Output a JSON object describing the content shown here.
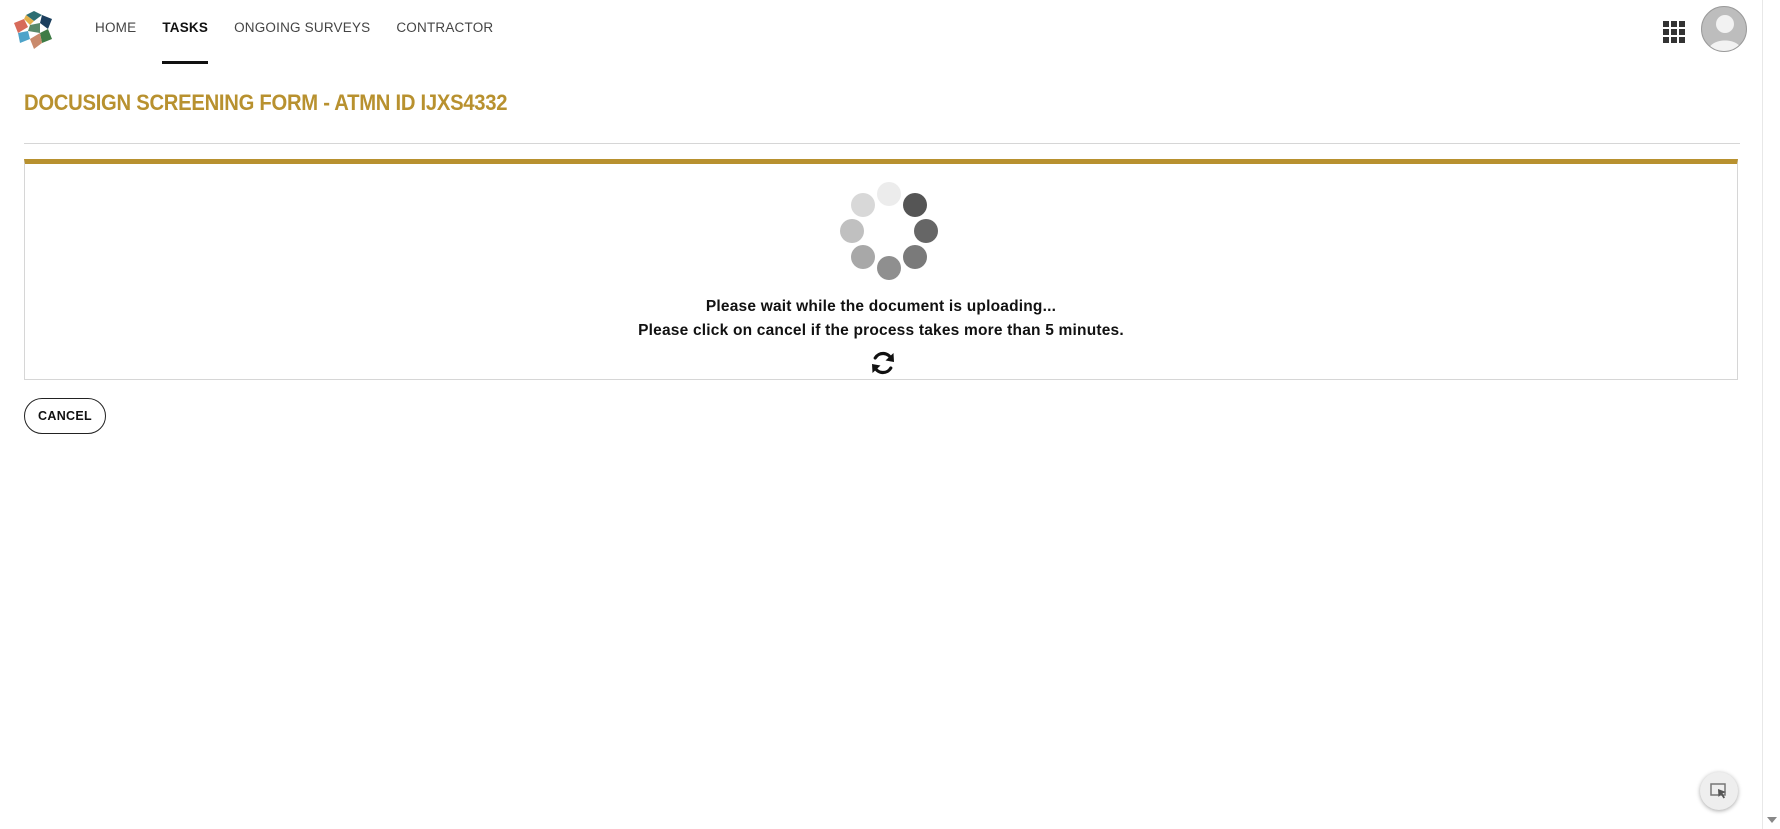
{
  "nav": {
    "items": [
      {
        "label": "HOME",
        "active": false
      },
      {
        "label": "TASKS",
        "active": true
      },
      {
        "label": "ONGOING SURVEYS",
        "active": false
      },
      {
        "label": "CONTRACTOR",
        "active": false
      }
    ]
  },
  "header": {
    "logo_icon": "hexagon-pattern-logo-icon",
    "apps_icon": "grid-apps-icon",
    "avatar_icon": "user-avatar-icon"
  },
  "page": {
    "title": "DOCUSIGN SCREENING FORM - ATMN ID IJXS4332"
  },
  "upload_panel": {
    "spinner_icon": "loading-spinner-icon",
    "message_line1": "Please wait while the document is uploading...",
    "message_line2": "Please click on cancel if the process takes more than 5 minutes.",
    "refresh_icon": "refresh-icon"
  },
  "actions": {
    "cancel_label": "CANCEL"
  },
  "helper": {
    "icon": "screen-select-icon"
  },
  "colors": {
    "accent": "#b8912f",
    "text": "#111111",
    "border": "#d6d6d6"
  }
}
